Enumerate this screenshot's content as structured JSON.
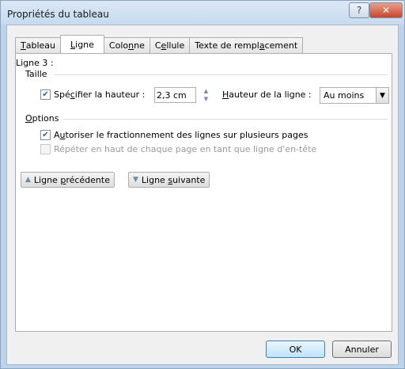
{
  "window": {
    "title": "Propriétés du tableau"
  },
  "titlebar": {
    "help_icon": "?",
    "close_icon": "✕"
  },
  "tabs": [
    {
      "pre": "",
      "u": "T",
      "post": "ableau"
    },
    {
      "pre": "",
      "u": "L",
      "post": "igne"
    },
    {
      "pre": "Colo",
      "u": "n",
      "post": "ne"
    },
    {
      "pre": "C",
      "u": "e",
      "post": "llule"
    },
    {
      "pre": "Texte de rempl",
      "u": "a",
      "post": "cement"
    }
  ],
  "row_heading": "Ligne 3 :",
  "size": {
    "group_label": "Taille",
    "specify_label": {
      "pre": "Spé",
      "u": "c",
      "post": "ifier la hauteur :"
    },
    "specify_checked": true,
    "height_value": "2,3 cm",
    "row_height_label": {
      "pre": "",
      "u": "H",
      "post": "auteur de la ligne :"
    },
    "row_height_select": "Au moins"
  },
  "options": {
    "group_label": {
      "pre": "",
      "u": "O",
      "post": "ptions"
    },
    "allow_break": {
      "pre": "A",
      "u": "u",
      "post": "toriser le fractionnement des lignes sur plusieurs pages",
      "checked": true
    },
    "repeat_header": {
      "text": "Répéter en haut de chaque page en tant que ligne d'en-tête",
      "checked": false
    }
  },
  "nav": {
    "previous": {
      "pre": "Ligne ",
      "u": "p",
      "post": "récédente"
    },
    "next": {
      "pre": "Ligne ",
      "u": "s",
      "post": "uivante"
    }
  },
  "buttons": {
    "ok": "OK",
    "cancel": "Annuler"
  },
  "colors": {
    "titlebar": "#c6daef",
    "close": "#c9462c",
    "checkmark": "#2a5db0"
  }
}
